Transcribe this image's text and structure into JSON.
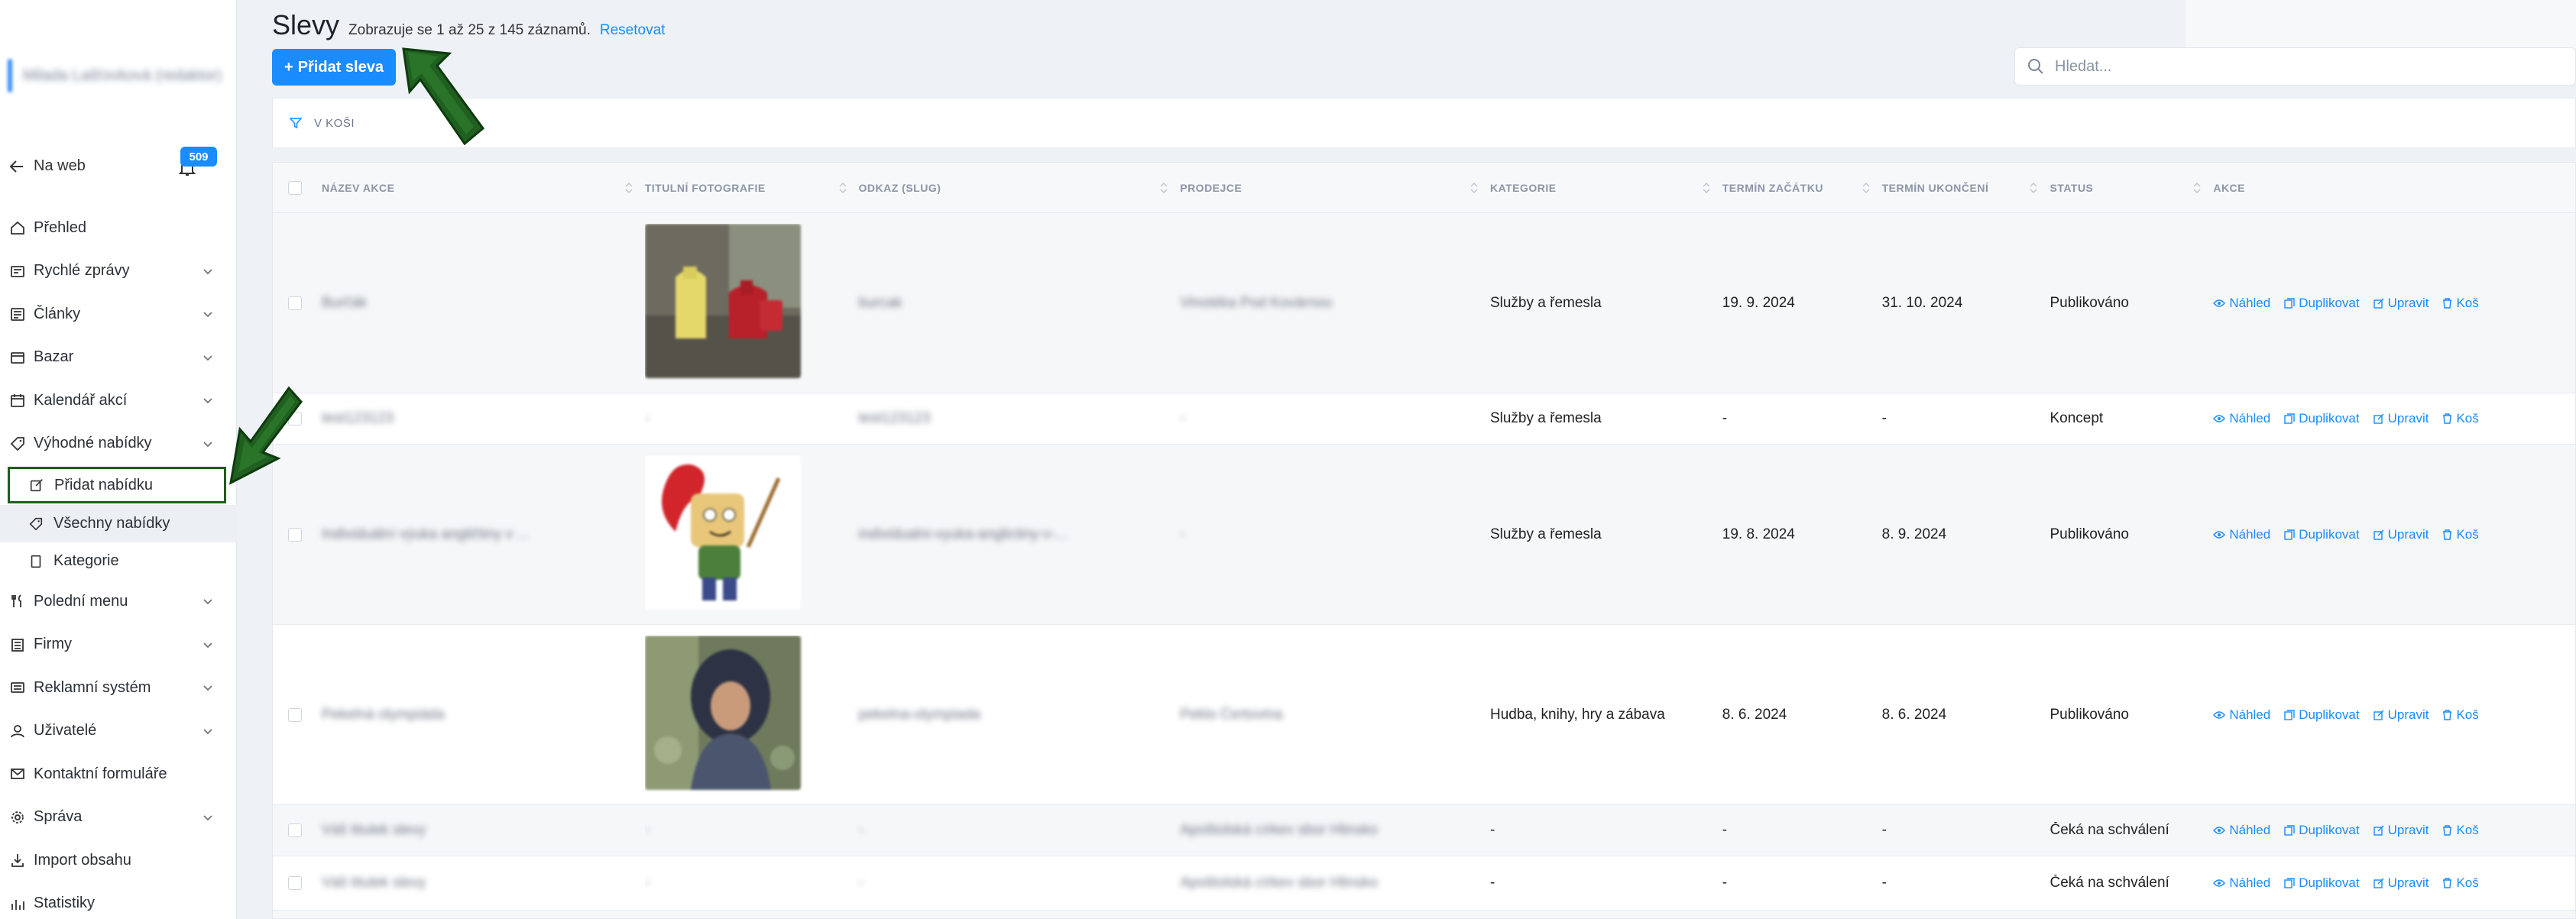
{
  "sidebar": {
    "account_name": "Milada Lašťovková (redaktor)",
    "back_label": "Na web",
    "notifications_count": "509",
    "items": [
      {
        "label": "Přehled",
        "icon": "home-icon",
        "expandable": false
      },
      {
        "label": "Rychlé zprávy",
        "icon": "news-icon",
        "expandable": true
      },
      {
        "label": "Články",
        "icon": "articles-icon",
        "expandable": true
      },
      {
        "label": "Bazar",
        "icon": "bazaar-icon",
        "expandable": true
      },
      {
        "label": "Kalendář akcí",
        "icon": "calendar-icon",
        "expandable": true
      },
      {
        "label": "Výhodné nabídky",
        "icon": "tag-icon",
        "expandable": true
      }
    ],
    "subitems": [
      {
        "label": "Přidat nabídku",
        "icon": "edit-icon"
      },
      {
        "label": "Všechny nabídky",
        "icon": "tag-icon"
      },
      {
        "label": "Kategorie",
        "icon": "document-icon"
      }
    ],
    "items_after": [
      {
        "label": "Polední menu",
        "icon": "cutlery-icon",
        "expandable": true
      },
      {
        "label": "Firmy",
        "icon": "building-icon",
        "expandable": true
      },
      {
        "label": "Reklamní systém",
        "icon": "ads-icon",
        "expandable": true
      },
      {
        "label": "Uživatelé",
        "icon": "user-icon",
        "expandable": true
      },
      {
        "label": "Kontaktní formuláře",
        "icon": "mail-icon",
        "expandable": false
      },
      {
        "label": "Správa",
        "icon": "settings-icon",
        "expandable": true
      },
      {
        "label": "Import obsahu",
        "icon": "import-icon",
        "expandable": false
      },
      {
        "label": "Statistiky",
        "icon": "stats-icon",
        "expandable": false
      }
    ]
  },
  "header": {
    "title": "Slevy",
    "summary": "Zobrazuje se 1 až 25 z 145 záznamů.",
    "reset_label": "Resetovat",
    "add_button_label": "Přidat sleva",
    "search_placeholder": "Hledat..."
  },
  "filter": {
    "label": "V KOŠI"
  },
  "table": {
    "columns": [
      "NÁZEV AKCE",
      "TITULNÍ FOTOGRAFIE",
      "ODKAZ (SLUG)",
      "PRODEJCE",
      "KATEGORIE",
      "TERMÍN ZAČÁTKU",
      "TERMÍN UKONČENÍ",
      "STATUS",
      "AKCE"
    ],
    "action_labels": {
      "preview": "Náhled",
      "duplicate": "Duplikovat",
      "edit": "Upravit",
      "trash": "Koš"
    },
    "rows": [
      {
        "name": "Burčák",
        "has_photo": true,
        "photo": "jugs",
        "slug": "burcak",
        "seller": "Vinotéka Pod Kovárnou",
        "category": "Služby a řemesla",
        "start": "19. 9. 2024",
        "end": "31. 10. 2024",
        "status": "Publikováno"
      },
      {
        "name": "test123123",
        "has_photo": false,
        "photo_text": "-",
        "slug": "test123123",
        "seller": "-",
        "category": "Služby a řemesla",
        "start": "-",
        "end": "-",
        "status": "Koncept"
      },
      {
        "name": "Individuální výuka angličtiny v ...",
        "has_photo": true,
        "photo": "cartoon",
        "slug": "individualni-vyuka-anglictiny-v-...",
        "seller": "-",
        "category": "Služby a řemesla",
        "start": "19. 8. 2024",
        "end": "8. 9. 2024",
        "status": "Publikováno"
      },
      {
        "name": "Pekelná olympiáda",
        "has_photo": true,
        "photo": "person",
        "slug": "pekelna-olympiada",
        "seller": "Peklo Čertovina",
        "category": "Hudba, knihy, hry a zábava",
        "start": "8. 6. 2024",
        "end": "8. 6. 2024",
        "status": "Publikováno"
      },
      {
        "name": "Váš titulek slevy",
        "has_photo": false,
        "photo_text": "-",
        "slug": "-",
        "seller": "Apoštolská církev sbor Hlinsko",
        "category": "-",
        "start": "-",
        "end": "-",
        "status": "Čeká na schválení"
      },
      {
        "name": "Váš titulek slevy",
        "has_photo": false,
        "photo_text": "-",
        "slug": "-",
        "seller": "Apoštolská církev sbor Hlinsko",
        "category": "-",
        "start": "-",
        "end": "-",
        "status": "Čeká na schválení"
      }
    ]
  },
  "colors": {
    "accent": "#1a8cff",
    "annotation": "#1f5f1f"
  }
}
